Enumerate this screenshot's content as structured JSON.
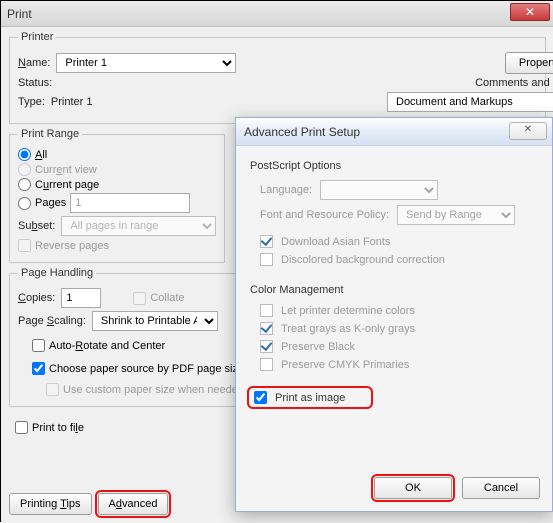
{
  "window": {
    "title": "Print",
    "close_glyph": "✕"
  },
  "printer": {
    "legend": "Printer",
    "name_label": "Name:",
    "name_value": "Printer 1",
    "properties_btn": "Properties",
    "status_label": "Status:",
    "type_label": "Type:",
    "type_value": "Printer 1",
    "comments_label": "Comments and Forms:",
    "comments_value": "Document and Markups"
  },
  "range": {
    "legend": "Print Range",
    "all": "All",
    "current_view": "Current view",
    "current_page": "Current page",
    "pages": "Pages",
    "pages_value": "1",
    "subset_label": "Subset:",
    "subset_value": "All pages in range",
    "reverse": "Reverse pages"
  },
  "handling": {
    "legend": "Page Handling",
    "copies_label": "Copies:",
    "copies_value": "1",
    "collate": "Collate",
    "scaling_label": "Page Scaling:",
    "scaling_value": "Shrink to Printable Area",
    "auto_rotate": "Auto-Rotate and Center",
    "choose_paper": "Choose paper source by PDF page size",
    "custom_paper": "Use custom paper size when needed"
  },
  "print_to_file": "Print to file",
  "bottom": {
    "tips": "Printing Tips",
    "advanced": "Advanced"
  },
  "adv": {
    "title": "Advanced Print Setup",
    "close_glyph": "✕",
    "ps_section": "PostScript Options",
    "language_label": "Language:",
    "font_policy_label": "Font and Resource Policy:",
    "font_policy_value": "Send by Range",
    "download_asian": "Download Asian Fonts",
    "disc_bg": "Discolored background correction",
    "color_section": "Color Management",
    "let_printer": "Let printer determine colors",
    "treat_grays": "Treat grays as K-only grays",
    "pres_black": "Preserve Black",
    "pres_cmyk": "Preserve CMYK Primaries",
    "print_as_image": "Print as image",
    "ok": "OK",
    "cancel": "Cancel"
  }
}
